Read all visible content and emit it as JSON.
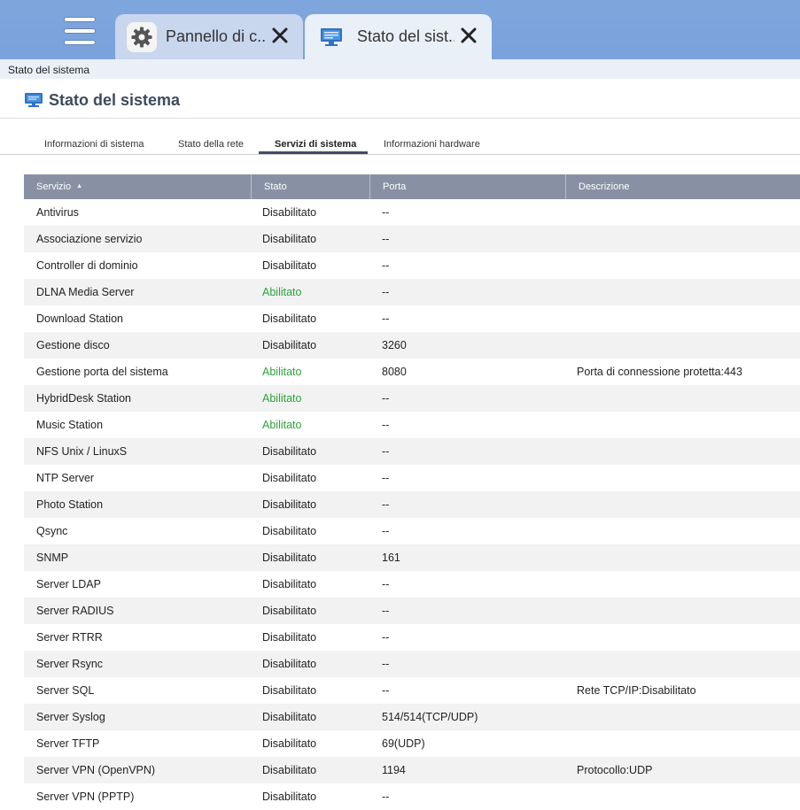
{
  "window": {
    "tabs": [
      {
        "label": "Pannello di c...",
        "icon": "gear-icon"
      },
      {
        "label": "Stato del sist...",
        "icon": "monitor-icon"
      }
    ]
  },
  "breadcrumb": "Stato del sistema",
  "page": {
    "title": "Stato del sistema"
  },
  "subtabs": [
    {
      "label": "Informazioni di sistema"
    },
    {
      "label": "Stato della rete"
    },
    {
      "label": "Servizi di sistema",
      "active": true
    },
    {
      "label": "Informazioni hardware"
    }
  ],
  "table": {
    "columns": [
      "Servizio",
      "Stato",
      "Porta",
      "Descrizione"
    ],
    "sort": {
      "column": "Servizio",
      "direction": "ascending"
    },
    "rows": [
      {
        "service": "Antivirus",
        "status": "Disabilitato",
        "port": "--",
        "description": ""
      },
      {
        "service": "Associazione servizio",
        "status": "Disabilitato",
        "port": "--",
        "description": ""
      },
      {
        "service": "Controller di dominio",
        "status": "Disabilitato",
        "port": "--",
        "description": ""
      },
      {
        "service": "DLNA Media Server",
        "status": "Abilitato",
        "port": "--",
        "description": ""
      },
      {
        "service": "Download Station",
        "status": "Disabilitato",
        "port": "--",
        "description": ""
      },
      {
        "service": "Gestione disco",
        "status": "Disabilitato",
        "port": "3260",
        "description": ""
      },
      {
        "service": "Gestione porta del sistema",
        "status": "Abilitato",
        "port": "8080",
        "description": "Porta di connessione protetta:443"
      },
      {
        "service": "HybridDesk Station",
        "status": "Abilitato",
        "port": "--",
        "description": ""
      },
      {
        "service": "Music Station",
        "status": "Abilitato",
        "port": "--",
        "description": ""
      },
      {
        "service": "NFS Unix / LinuxS",
        "status": "Disabilitato",
        "port": "--",
        "description": ""
      },
      {
        "service": "NTP Server",
        "status": "Disabilitato",
        "port": "--",
        "description": ""
      },
      {
        "service": "Photo Station",
        "status": "Disabilitato",
        "port": "--",
        "description": ""
      },
      {
        "service": "Qsync",
        "status": "Disabilitato",
        "port": "--",
        "description": ""
      },
      {
        "service": "SNMP",
        "status": "Disabilitato",
        "port": "161",
        "description": ""
      },
      {
        "service": "Server LDAP",
        "status": "Disabilitato",
        "port": "--",
        "description": ""
      },
      {
        "service": "Server RADIUS",
        "status": "Disabilitato",
        "port": "--",
        "description": ""
      },
      {
        "service": "Server RTRR",
        "status": "Disabilitato",
        "port": "--",
        "description": ""
      },
      {
        "service": "Server Rsync",
        "status": "Disabilitato",
        "port": "--",
        "description": ""
      },
      {
        "service": "Server SQL",
        "status": "Disabilitato",
        "port": "--",
        "description": "Rete TCP/IP:Disabilitato"
      },
      {
        "service": "Server Syslog",
        "status": "Disabilitato",
        "port": "514/514(TCP/UDP)",
        "description": ""
      },
      {
        "service": "Server TFTP",
        "status": "Disabilitato",
        "port": "69(UDP)",
        "description": ""
      },
      {
        "service": "Server VPN (OpenVPN)",
        "status": "Disabilitato",
        "port": "1194",
        "description": "Protocollo:UDP"
      },
      {
        "service": "Server VPN (PPTP)",
        "status": "Disabilitato",
        "port": "--",
        "description": ""
      }
    ]
  },
  "colors": {
    "topbar": "#7aa2db",
    "header_row": "#8891a4",
    "enabled_status": "#2aa33a",
    "title_text": "#3d4a5c"
  }
}
